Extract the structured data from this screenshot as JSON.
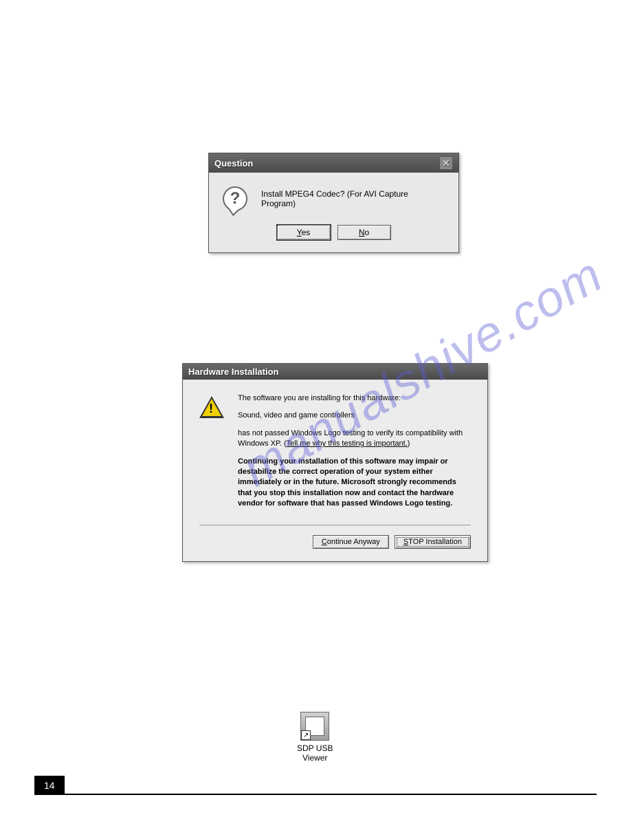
{
  "watermark": "manualshive.com",
  "question_dialog": {
    "title": "Question",
    "message": "Install MPEG4 Codec? (For AVI Capture Program)",
    "yes_label": "Yes",
    "no_label": "No"
  },
  "hardware_dialog": {
    "title": "Hardware Installation",
    "intro": "The software you are installing for this hardware:",
    "device": "Sound, video and game controllers",
    "warning_line": "has not passed Windows Logo testing to verify its compatibility with Windows XP. (",
    "link_text": "Tell me why this testing is important.",
    "warning_close": ")",
    "bold_warning": "Continuing your installation of this software may impair or destabilize the correct operation of your system either immediately or in the future. Microsoft strongly recommends that you stop this installation now and contact the hardware vendor for software that has passed Windows Logo testing.",
    "continue_label": "Continue Anyway",
    "stop_label": "STOP Installation",
    "continue_u": "C",
    "stop_u": "S"
  },
  "desktop_icon": {
    "line1": "SDP USB",
    "line2": "Viewer"
  },
  "page_number": "14"
}
